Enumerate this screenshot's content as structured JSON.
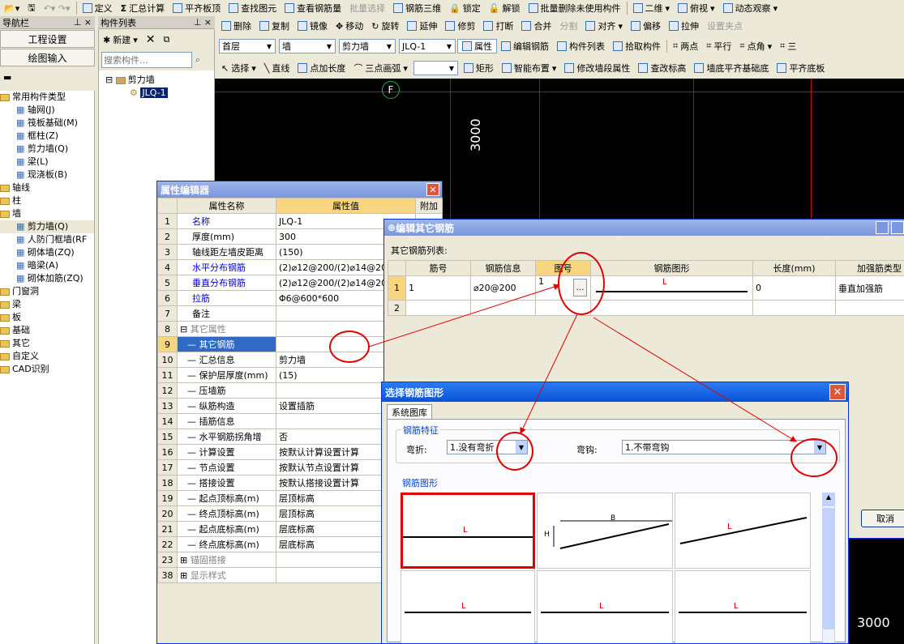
{
  "toolbar1": {
    "items": [
      "定义",
      "汇总计算",
      "平齐板顶",
      "查找图元",
      "查看钢筋量",
      "批量选择",
      "钢筋三维",
      "锁定",
      "解锁",
      "批量删除未使用构件"
    ],
    "view_mode": "二维",
    "view": "俯视",
    "observe": "动态观察"
  },
  "toolbar2": {
    "items": [
      "删除",
      "复制",
      "镜像",
      "移动",
      "旋转",
      "延伸",
      "修剪",
      "打断",
      "合并",
      "分割",
      "对齐",
      "偏移",
      "拉伸",
      "设置夹点"
    ]
  },
  "toolbar3": {
    "floor": "首层",
    "type": "墙",
    "subtype": "剪力墙",
    "member": "JLQ-1",
    "items": [
      "属性",
      "编辑钢筋",
      "构件列表",
      "拾取构件",
      "两点",
      "平行",
      "点角",
      "三"
    ]
  },
  "toolbar4": {
    "items": [
      "选择",
      "直线",
      "点加长度",
      "三点画弧",
      "矩形",
      "智能布置",
      "修改墙段属性",
      "查改标高",
      "墙底平齐基础底",
      "平齐底板"
    ]
  },
  "nav": {
    "title": "导航栏",
    "btn_project": "工程设置",
    "btn_draw": "绘图输入",
    "tree": [
      {
        "label": "常用构件类型",
        "level": 0
      },
      {
        "label": "轴网(J)",
        "level": 1
      },
      {
        "label": "筏板基础(M)",
        "level": 1
      },
      {
        "label": "框柱(Z)",
        "level": 1
      },
      {
        "label": "剪力墙(Q)",
        "level": 1
      },
      {
        "label": "梁(L)",
        "level": 1
      },
      {
        "label": "现浇板(B)",
        "level": 1
      },
      {
        "label": "轴线",
        "level": 0
      },
      {
        "label": "柱",
        "level": 0
      },
      {
        "label": "墙",
        "level": 0
      },
      {
        "label": "剪力墙(Q)",
        "level": 1
      },
      {
        "label": "人防门框墙(RF",
        "level": 1
      },
      {
        "label": "砌体墙(ZQ)",
        "level": 1
      },
      {
        "label": "暗梁(A)",
        "level": 1
      },
      {
        "label": "砌体加筋(ZQ)",
        "level": 1
      },
      {
        "label": "门窗洞",
        "level": 0
      },
      {
        "label": "梁",
        "level": 0
      },
      {
        "label": "板",
        "level": 0
      },
      {
        "label": "基础",
        "level": 0
      },
      {
        "label": "其它",
        "level": 0
      },
      {
        "label": "自定义",
        "level": 0
      },
      {
        "label": "CAD识别",
        "level": 0
      }
    ]
  },
  "list": {
    "title": "构件列表",
    "new": "新建",
    "search_placeholder": "搜索构件...",
    "root": "剪力墙",
    "item": "JLQ-1"
  },
  "cad": {
    "axis": "F",
    "dim1": "3000",
    "dim2": "3000"
  },
  "prop": {
    "title": "属性编辑器",
    "col_name": "属性名称",
    "col_value": "属性值",
    "col_extra": "附加",
    "rows": [
      {
        "n": "1",
        "name": "名称",
        "val": "JLQ-1",
        "style": "blue"
      },
      {
        "n": "2",
        "name": "厚度(mm)",
        "val": "300",
        "style": ""
      },
      {
        "n": "3",
        "name": "轴线距左墙皮距离",
        "val": "(150)",
        "style": ""
      },
      {
        "n": "4",
        "name": "水平分布钢筋",
        "val": "(2)⌀12@200/(2)⌀14@20",
        "style": "blue"
      },
      {
        "n": "5",
        "name": "垂直分布钢筋",
        "val": "(2)⌀12@200/(2)⌀14@20",
        "style": "blue"
      },
      {
        "n": "6",
        "name": "拉筋",
        "val": "Φ6@600*600",
        "style": "blue"
      },
      {
        "n": "7",
        "name": "备注",
        "val": "",
        "style": ""
      },
      {
        "n": "8",
        "name": "其它属性",
        "val": "",
        "style": "group"
      },
      {
        "n": "9",
        "name": "其它钢筋",
        "val": "",
        "style": "sel"
      },
      {
        "n": "10",
        "name": "汇总信息",
        "val": "剪力墙",
        "style": "sub"
      },
      {
        "n": "11",
        "name": "保护层厚度(mm)",
        "val": "(15)",
        "style": "sub"
      },
      {
        "n": "12",
        "name": "压墙筋",
        "val": "",
        "style": "sub"
      },
      {
        "n": "13",
        "name": "纵筋构造",
        "val": "设置插筋",
        "style": "sub"
      },
      {
        "n": "14",
        "name": "插筋信息",
        "val": "",
        "style": "sub"
      },
      {
        "n": "15",
        "name": "水平钢筋拐角增",
        "val": "否",
        "style": "sub"
      },
      {
        "n": "16",
        "name": "计算设置",
        "val": "按默认计算设置计算",
        "style": "sub"
      },
      {
        "n": "17",
        "name": "节点设置",
        "val": "按默认节点设置计算",
        "style": "sub"
      },
      {
        "n": "18",
        "name": "搭接设置",
        "val": "按默认搭接设置计算",
        "style": "sub"
      },
      {
        "n": "19",
        "name": "起点顶标高(m)",
        "val": "层顶标高",
        "style": "sub"
      },
      {
        "n": "20",
        "name": "终点顶标高(m)",
        "val": "层顶标高",
        "style": "sub"
      },
      {
        "n": "21",
        "name": "起点底标高(m)",
        "val": "层底标高",
        "style": "sub"
      },
      {
        "n": "22",
        "name": "终点底标高(m)",
        "val": "层底标高",
        "style": "sub"
      },
      {
        "n": "23",
        "name": "锚固搭接",
        "val": "",
        "style": "group"
      },
      {
        "n": "38",
        "name": "显示样式",
        "val": "",
        "style": "group"
      }
    ]
  },
  "other": {
    "title": "编辑其它钢筋",
    "list_label": "其它钢筋列表:",
    "cols": [
      "筋号",
      "钢筋信息",
      "图号",
      "钢筋图形",
      "长度(mm)",
      "加强筋类型"
    ],
    "row1": {
      "n": "1",
      "no": "1",
      "info": "⌀20@200",
      "fig": "1",
      "shape_label": "L",
      "len": "0",
      "type": "垂直加强筋"
    },
    "row2": {
      "n": "2"
    },
    "cancel": "取消"
  },
  "shape": {
    "title": "选择钢筋图形",
    "tab": "系统图库",
    "feature_label": "钢筋特征",
    "bend_label": "弯折:",
    "bend_value": "1.没有弯折",
    "hook_label": "弯钩:",
    "hook_value": "1.不带弯钩",
    "shapes_label": "钢筋图形",
    "labels": {
      "L": "L",
      "B": "B",
      "H": "H"
    }
  },
  "colors": {
    "annot": "#e00000",
    "cad_grid": "#cc0000",
    "title_bar": "#0a52d8"
  }
}
